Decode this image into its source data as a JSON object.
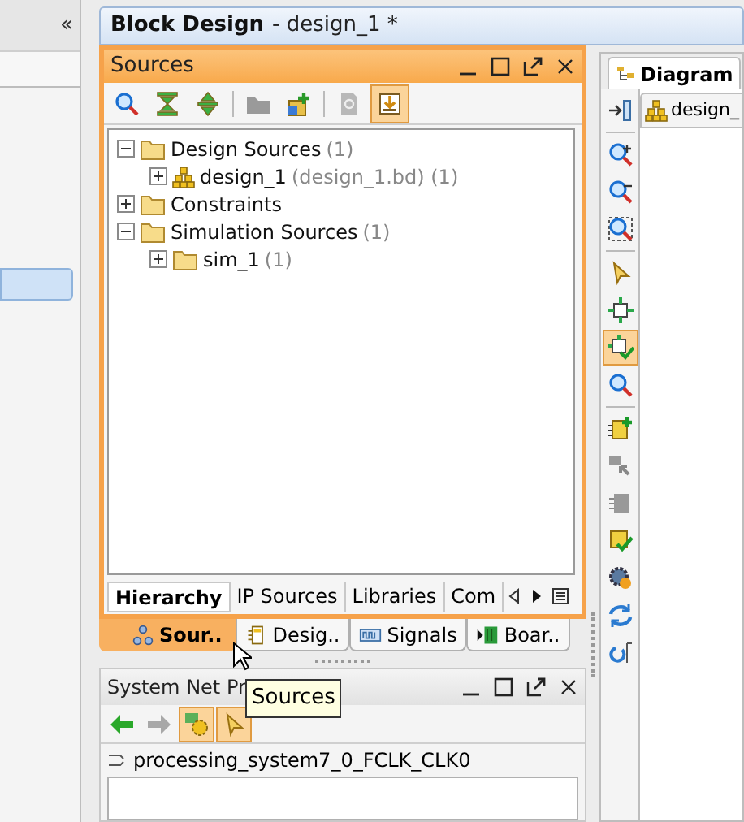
{
  "left_panel": {
    "collapse_glyph": "«"
  },
  "window": {
    "title": "Block Design",
    "subtitle": "- design_1 *"
  },
  "sources": {
    "title": "Sources",
    "toolbar": [
      {
        "kind": "search",
        "selected": false
      },
      {
        "kind": "collapse",
        "selected": false
      },
      {
        "kind": "expand",
        "selected": false
      },
      {
        "kind": "folder",
        "selected": false
      },
      {
        "kind": "add",
        "selected": false
      },
      {
        "kind": "doc",
        "selected": false
      },
      {
        "kind": "import",
        "selected": true
      }
    ],
    "tree": [
      {
        "label": "Design Sources",
        "suffix": "(1)",
        "kind": "folder",
        "expanded": true,
        "children": [
          {
            "label": "design_1",
            "suffix": "(design_1.bd) (1)",
            "kind": "design",
            "expanded": false
          }
        ]
      },
      {
        "label": "Constraints",
        "kind": "folder",
        "expanded": false
      },
      {
        "label": "Simulation Sources",
        "suffix": "(1)",
        "kind": "folder",
        "expanded": true,
        "children": [
          {
            "label": "sim_1",
            "suffix": "(1)",
            "kind": "folder",
            "expanded": false
          }
        ]
      }
    ],
    "tabs": [
      {
        "label": "Hierarchy",
        "selected": true
      },
      {
        "label": "IP Sources",
        "selected": false
      },
      {
        "label": "Libraries",
        "selected": false
      },
      {
        "label": "Com",
        "selected": false
      }
    ]
  },
  "dock_tabs": [
    {
      "label": "Sour..",
      "kind": "sources",
      "selected": true
    },
    {
      "label": "Desig..",
      "kind": "design",
      "selected": false
    },
    {
      "label": "Signals",
      "kind": "signals",
      "selected": false
    },
    {
      "label": "Boar..",
      "kind": "board",
      "selected": false
    }
  ],
  "diagram": {
    "tab": "Diagram",
    "subtab": "design_",
    "toolbar": [
      {
        "kind": "dock",
        "selected": false
      },
      {
        "kind": "zoom-in",
        "selected": false
      },
      {
        "kind": "zoom-out",
        "selected": false
      },
      {
        "kind": "zoom-fit",
        "selected": false
      },
      {
        "kind": "select",
        "selected": false
      },
      {
        "kind": "fit",
        "selected": false
      },
      {
        "kind": "autofit",
        "selected": true
      },
      {
        "kind": "search",
        "selected": false
      },
      {
        "kind": "add-ip",
        "selected": false
      },
      {
        "kind": "port",
        "selected": false
      },
      {
        "kind": "chip",
        "selected": false
      },
      {
        "kind": "validate",
        "selected": false
      },
      {
        "kind": "settings",
        "selected": false
      },
      {
        "kind": "refresh",
        "selected": false
      },
      {
        "kind": "regenerate",
        "selected": false
      }
    ]
  },
  "net_panel": {
    "title": "System Net Pr",
    "toolbar": [
      {
        "kind": "back",
        "selected": false
      },
      {
        "kind": "forward",
        "selected": false
      },
      {
        "kind": "properties",
        "selected": true
      },
      {
        "kind": "select",
        "selected": true
      }
    ],
    "net": "processing_system7_0_FCLK_CLK0"
  },
  "tooltip": "Sources"
}
